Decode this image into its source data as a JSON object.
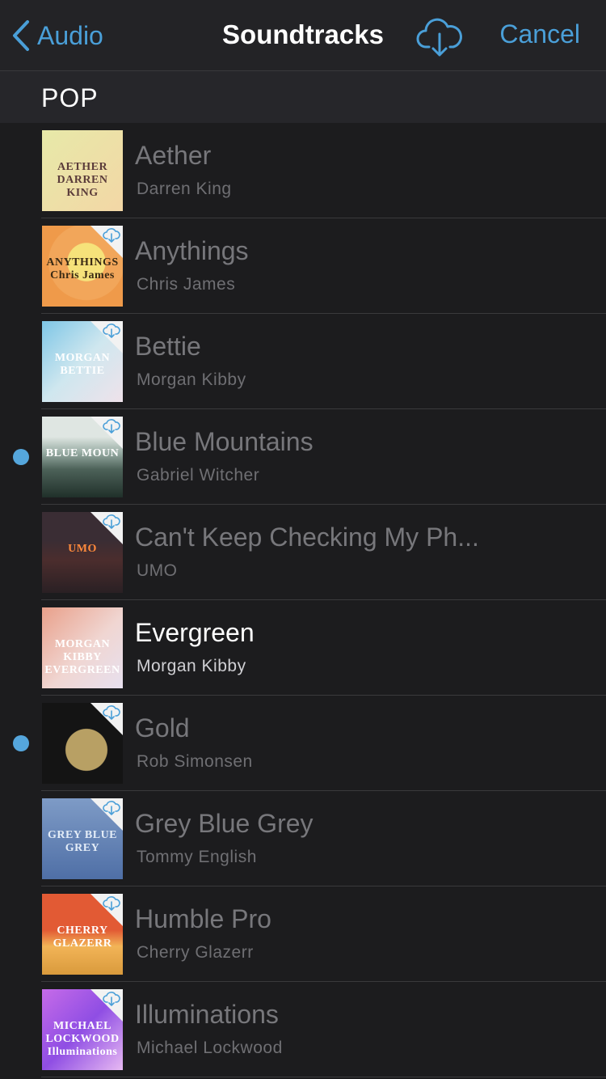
{
  "nav": {
    "back_label": "Audio",
    "title": "Soundtracks",
    "download_icon": "cloud-download-icon",
    "cancel_label": "Cancel",
    "accent_color": "#4a9fd8"
  },
  "section": {
    "title": "POP"
  },
  "tracks": [
    {
      "title": "Aether",
      "artist": "Darren King",
      "art_text": "AETHER DARREN KING",
      "cloud": false,
      "dot": false,
      "active": false
    },
    {
      "title": "Anythings",
      "artist": "Chris James",
      "art_text": "ANYTHINGS Chris James",
      "cloud": true,
      "dot": false,
      "active": false
    },
    {
      "title": "Bettie",
      "artist": "Morgan Kibby",
      "art_text": "MORGAN BETTIE",
      "cloud": true,
      "dot": false,
      "active": false
    },
    {
      "title": "Blue Mountains",
      "artist": "Gabriel Witcher",
      "art_text": "BLUE MOUN",
      "cloud": true,
      "dot": true,
      "active": false
    },
    {
      "title": "Can't Keep Checking My Ph...",
      "artist": "UMO",
      "art_text": "UMO",
      "cloud": true,
      "dot": false,
      "active": false
    },
    {
      "title": "Evergreen",
      "artist": "Morgan Kibby",
      "art_text": "MORGAN KIBBY EVERGREEN",
      "cloud": false,
      "dot": false,
      "active": true
    },
    {
      "title": "Gold",
      "artist": "Rob Simonsen",
      "art_text": "",
      "cloud": true,
      "dot": true,
      "active": false
    },
    {
      "title": "Grey Blue Grey",
      "artist": "Tommy English",
      "art_text": "GREY BLUE GREY",
      "cloud": true,
      "dot": false,
      "active": false
    },
    {
      "title": "Humble Pro",
      "artist": "Cherry Glazerr",
      "art_text": "CHERRY GLAZERR",
      "cloud": true,
      "dot": false,
      "active": false
    },
    {
      "title": "Illuminations",
      "artist": "Michael Lockwood",
      "art_text": "MICHAEL LOCKWOOD Illuminations",
      "cloud": true,
      "dot": false,
      "active": false
    }
  ],
  "artwork_styles": [
    {
      "bg": "linear-gradient(135deg,#e7e9a8,#f3d7a6)",
      "fg": "#5a3b3a"
    },
    {
      "bg": "radial-gradient(circle at 55% 45%,#f6e27a 0 30%,#f2a65a 31% 60%,#ef9a4a 61%)",
      "fg": "#3a2a14"
    },
    {
      "bg": "linear-gradient(135deg,#7ec6e6,#cfe7ef 50%,#efe2ea)",
      "fg": "#ffffff"
    },
    {
      "bg": "linear-gradient(180deg,#dfe6e2 0 25%,#96aaa2 45%,#4d6259 65%,#20302a)",
      "fg": "#ffffff"
    },
    {
      "bg": "linear-gradient(180deg,#3a2d34 0 35%,#4b2d2d 60%,#2a2024)",
      "fg": "#ff8a3c"
    },
    {
      "bg": "linear-gradient(135deg,#e9a08a,#f0d6d2 55%,#e7e0ef)",
      "fg": "#ffffff"
    },
    {
      "bg": "radial-gradient(circle at 55% 58%,#b8a064 0 32%,#141414 33%)",
      "fg": "#b8a064"
    },
    {
      "bg": "linear-gradient(180deg,#7e9bc6,#4f6fa6)",
      "fg": "#e3ecf7"
    },
    {
      "bg": "linear-gradient(180deg,#e25a34 0 45%,#f2b457 65%,#d99a3c)",
      "fg": "#ffffff"
    },
    {
      "bg": "linear-gradient(135deg,#c66be8,#8f4ee4 50%,#e7b9f2)",
      "fg": "#ffffff"
    }
  ],
  "dot_color": "#55a6dc"
}
